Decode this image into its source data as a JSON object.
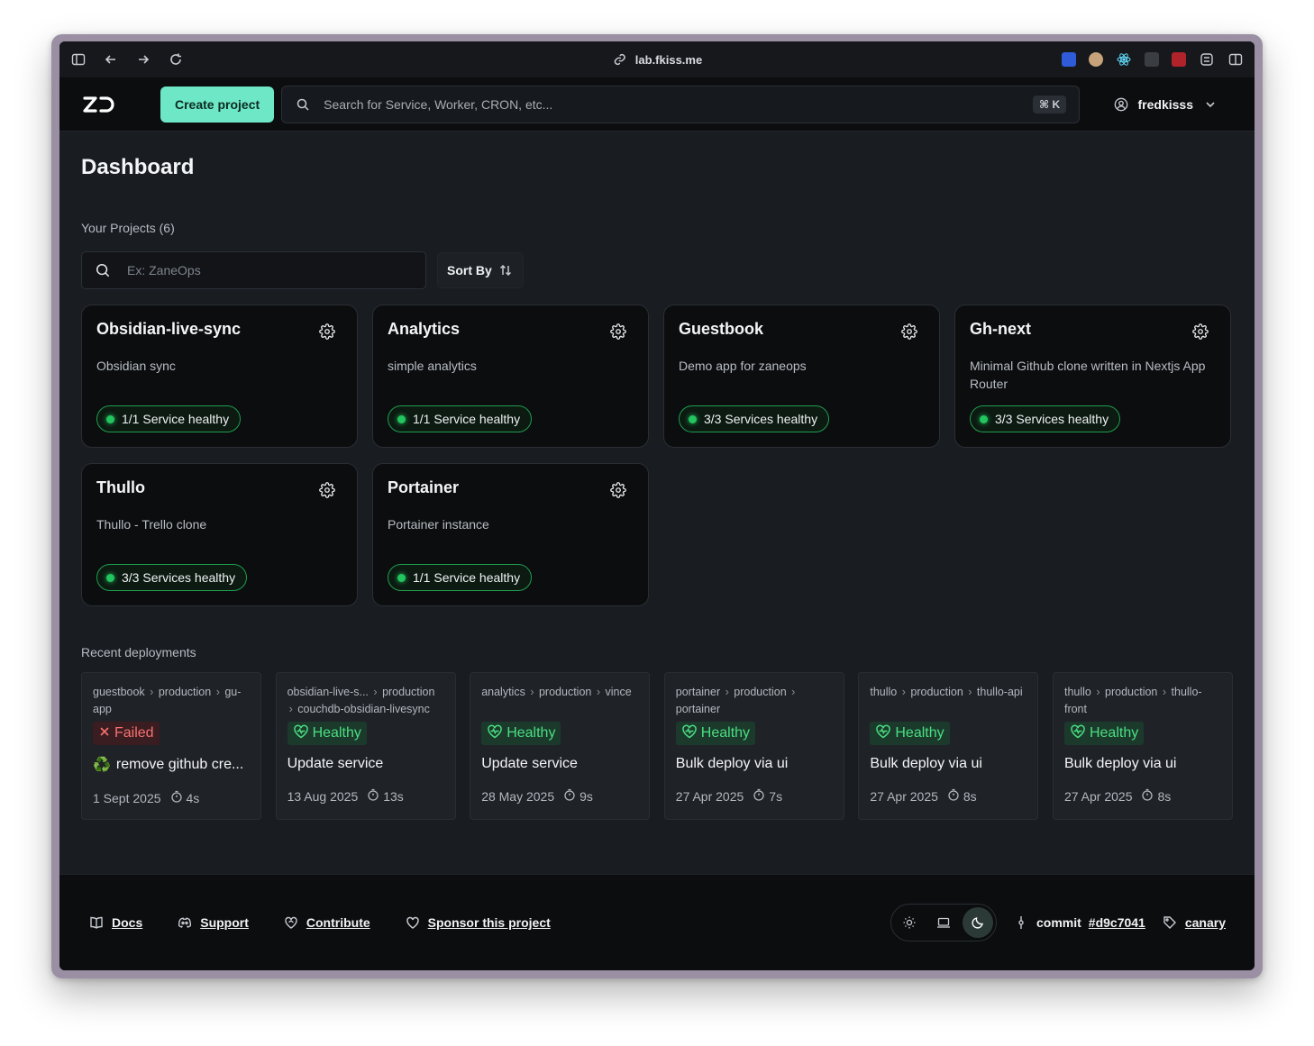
{
  "browser": {
    "url": "lab.fkiss.me"
  },
  "header": {
    "create_label": "Create project",
    "search_placeholder": "Search for Service, Worker, CRON, etc...",
    "shortcut": "⌘ K",
    "username": "fredkisss"
  },
  "page": {
    "title": "Dashboard",
    "projects_label": "Your Projects (6)",
    "project_search_placeholder": "Ex: ZaneOps",
    "sort_label": "Sort By",
    "recent_label": "Recent deployments"
  },
  "projects": [
    {
      "name": "Obsidian-live-sync",
      "description": "Obsidian sync",
      "status": "1/1 Service healthy"
    },
    {
      "name": "Analytics",
      "description": "simple analytics",
      "status": "1/1 Service healthy"
    },
    {
      "name": "Guestbook",
      "description": "Demo app for zaneops",
      "status": "3/3 Services healthy"
    },
    {
      "name": "Gh-next",
      "description": "Minimal Github clone written in Nextjs App Router",
      "status": "3/3 Services healthy"
    },
    {
      "name": "Thullo",
      "description": "Thullo - Trello clone",
      "status": "3/3 Services healthy"
    },
    {
      "name": "Portainer",
      "description": "Portainer instance",
      "status": "1/1 Service healthy"
    }
  ],
  "deployments": [
    {
      "project": "guestbook",
      "env": "production",
      "service": "gu-app",
      "status": "Failed",
      "message": "remove github cre...",
      "emoji": "♻️",
      "date": "1 Sept 2025",
      "duration": "4s"
    },
    {
      "project": "obsidian-live-s...",
      "env": "production",
      "service": "couchdb-obsidian-livesync",
      "status": "Healthy",
      "message": "Update service",
      "emoji": "",
      "date": "13 Aug 2025",
      "duration": "13s"
    },
    {
      "project": "analytics",
      "env": "production",
      "service": "vince",
      "status": "Healthy",
      "message": "Update service",
      "emoji": "",
      "date": "28 May 2025",
      "duration": "9s"
    },
    {
      "project": "portainer",
      "env": "production",
      "service": "portainer",
      "status": "Healthy",
      "message": "Bulk deploy via ui",
      "emoji": "",
      "date": "27 Apr 2025",
      "duration": "7s"
    },
    {
      "project": "thullo",
      "env": "production",
      "service": "thullo-api",
      "status": "Healthy",
      "message": "Bulk deploy via ui",
      "emoji": "",
      "date": "27 Apr 2025",
      "duration": "8s"
    },
    {
      "project": "thullo",
      "env": "production",
      "service": "thullo-front",
      "status": "Healthy",
      "message": "Bulk deploy via ui",
      "emoji": "",
      "date": "27 Apr 2025",
      "duration": "8s"
    }
  ],
  "footer": {
    "docs": "Docs",
    "support": "Support",
    "contribute": "Contribute",
    "sponsor": "Sponsor this project",
    "commit_label": "commit",
    "commit_hash": "#d9c7041",
    "channel": "canary"
  },
  "colors": {
    "accent": "#6ee7c7",
    "healthy": "#22c55e",
    "failed": "#f87171"
  }
}
